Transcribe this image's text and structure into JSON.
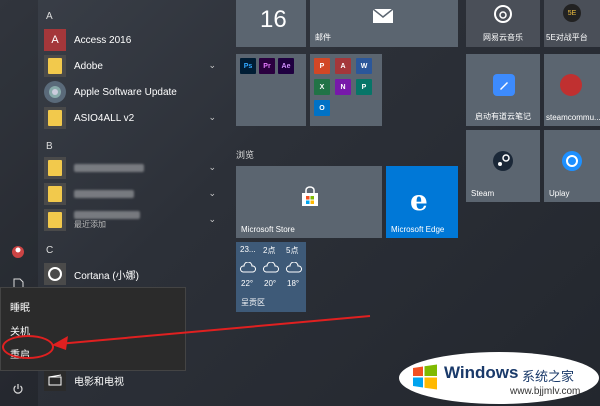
{
  "app_list": {
    "letters": {
      "a": "A",
      "b": "B",
      "c": "C"
    },
    "items": {
      "access": "Access 2016",
      "adobe": "Adobe",
      "apple_update": "Apple Software Update",
      "asio": "ASIO4ALL v2",
      "recent_new": "最近添加",
      "cortana": "Cortana (小娜)",
      "movies": "电影和电视"
    }
  },
  "power_menu": {
    "sleep": "睡眠",
    "shutdown": "关机",
    "restart": "重启"
  },
  "tiles": {
    "calendar_day": "16",
    "mail": "邮件",
    "netease_music": "网易云音乐",
    "fivee": "5E对战平台",
    "qq_notes": "启动有道云笔记",
    "steam_community": "steamcommu...",
    "steam": "Steam",
    "uplay": "Uplay",
    "browse_group": "浏览",
    "store": "Microsoft Store",
    "edge": "Microsoft Edge",
    "weather": {
      "times": [
        "23...",
        "2点",
        "5点"
      ],
      "temps": [
        "22°",
        "20°",
        "18°"
      ],
      "location": "呈贡区"
    },
    "mini_office": [
      "P",
      "A",
      "W",
      "X",
      "N"
    ],
    "mini_adobe": [
      "Ps",
      "Pr",
      "Ae"
    ]
  },
  "watermark": {
    "brand": "Windows",
    "sub": "系统之家",
    "url": "www.bjjmlv.com"
  },
  "colors": {
    "accent": "#0078d7",
    "annotation": "#e02020"
  }
}
